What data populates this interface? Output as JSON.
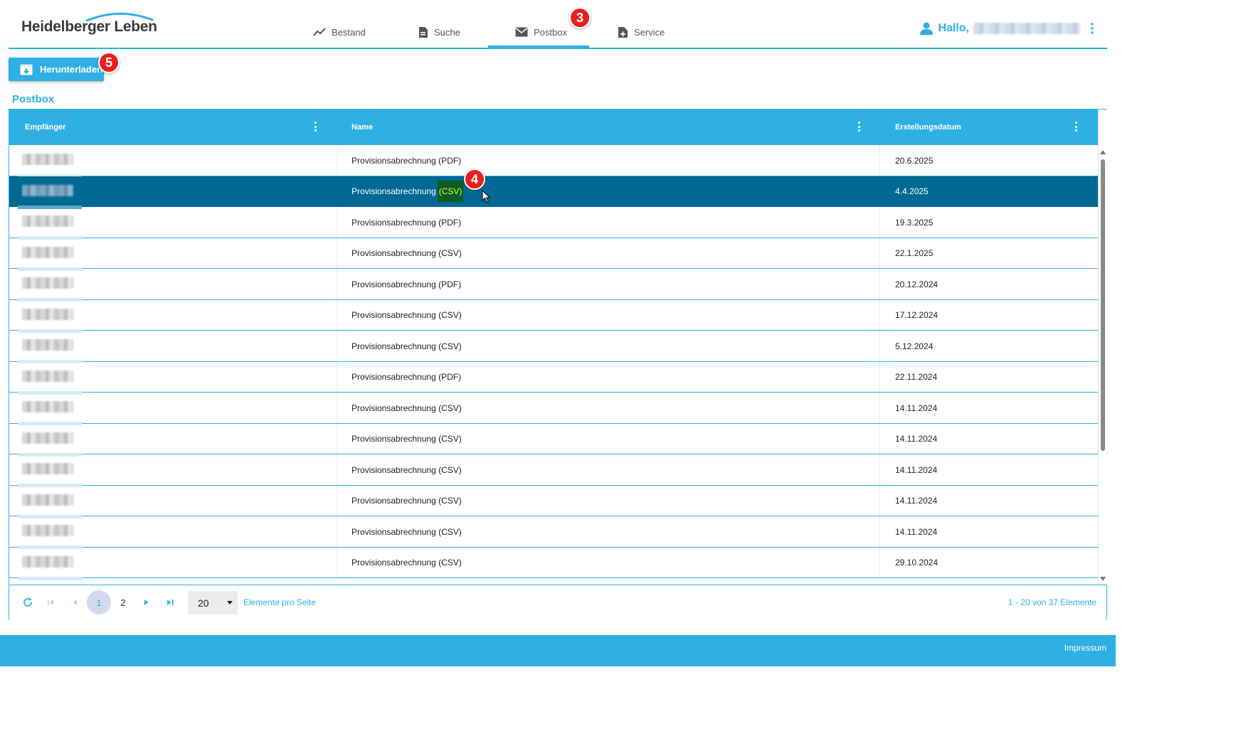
{
  "header": {
    "logo_text": "Heidelberger Leben",
    "nav": [
      {
        "label": "Bestand",
        "icon": "chart-line-icon"
      },
      {
        "label": "Suche",
        "icon": "document-icon"
      },
      {
        "label": "Postbox",
        "icon": "envelope-icon",
        "active": true
      },
      {
        "label": "Service",
        "icon": "document-add-icon"
      }
    ],
    "greeting": "Hallo,",
    "user_icon": "user-icon",
    "menu_icon": "more-vertical-icon"
  },
  "badges": {
    "postbox": "3",
    "selected_row": "4",
    "download": "5"
  },
  "toolbar": {
    "download_label": "Herunterladen",
    "download_icon": "archive-download-icon"
  },
  "section_title": "Postbox",
  "grid": {
    "columns": [
      "Empfänger",
      "Name",
      "Erstellungsdatum"
    ],
    "rows": [
      {
        "name": "Provisionsabrechnung (PDF)",
        "name_base": "Provisionsabrechnung",
        "name_suffix": "(PDF)",
        "date": "20.6.2025"
      },
      {
        "name": "Provisionsabrechnung (CSV)",
        "name_base": "Provisionsabrechnung",
        "name_suffix": "(CSV)",
        "date": "4.4.2025",
        "selected": true
      },
      {
        "name": "Provisionsabrechnung (PDF)",
        "name_base": "Provisionsabrechnung",
        "name_suffix": "(PDF)",
        "date": "19.3.2025"
      },
      {
        "name": "Provisionsabrechnung (CSV)",
        "name_base": "Provisionsabrechnung",
        "name_suffix": "(CSV)",
        "date": "22.1.2025"
      },
      {
        "name": "Provisionsabrechnung (PDF)",
        "name_base": "Provisionsabrechnung",
        "name_suffix": "(PDF)",
        "date": "20.12.2024"
      },
      {
        "name": "Provisionsabrechnung (CSV)",
        "name_base": "Provisionsabrechnung",
        "name_suffix": "(CSV)",
        "date": "17.12.2024"
      },
      {
        "name": "Provisionsabrechnung (CSV)",
        "name_base": "Provisionsabrechnung",
        "name_suffix": "(CSV)",
        "date": "5.12.2024"
      },
      {
        "name": "Provisionsabrechnung (PDF)",
        "name_base": "Provisionsabrechnung",
        "name_suffix": "(PDF)",
        "date": "22.11.2024"
      },
      {
        "name": "Provisionsabrechnung (CSV)",
        "name_base": "Provisionsabrechnung",
        "name_suffix": "(CSV)",
        "date": "14.11.2024"
      },
      {
        "name": "Provisionsabrechnung (CSV)",
        "name_base": "Provisionsabrechnung",
        "name_suffix": "(CSV)",
        "date": "14.11.2024"
      },
      {
        "name": "Provisionsabrechnung (CSV)",
        "name_base": "Provisionsabrechnung",
        "name_suffix": "(CSV)",
        "date": "14.11.2024"
      },
      {
        "name": "Provisionsabrechnung (CSV)",
        "name_base": "Provisionsabrechnung",
        "name_suffix": "(CSV)",
        "date": "14.11.2024"
      },
      {
        "name": "Provisionsabrechnung (CSV)",
        "name_base": "Provisionsabrechnung",
        "name_suffix": "(CSV)",
        "date": "14.11.2024"
      },
      {
        "name": "Provisionsabrechnung (CSV)",
        "name_base": "Provisionsabrechnung",
        "name_suffix": "(CSV)",
        "date": "29.10.2024"
      }
    ]
  },
  "pager": {
    "pages": [
      "1",
      "2"
    ],
    "current_page": "1",
    "page_size": "20",
    "page_size_label": "Elemente pro Seite",
    "info": "1 - 20 von 37 Elemente"
  },
  "footer": {
    "impressum": "Impressum"
  },
  "colors": {
    "accent": "#2eb0e4",
    "selected_row": "#006994",
    "badge": "#e8201d",
    "highlight_bg": "#0d5c23",
    "highlight_fg": "#e3ff3c"
  }
}
